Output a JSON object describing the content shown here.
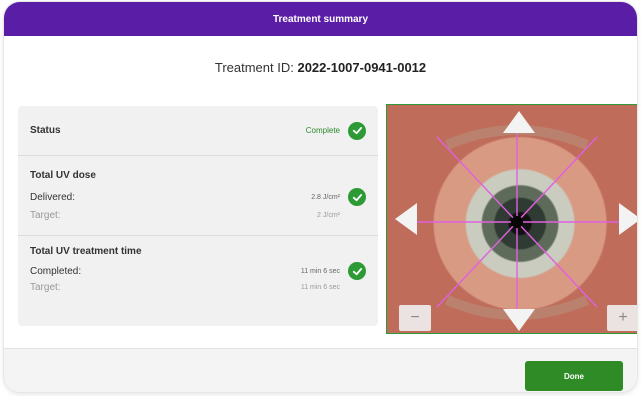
{
  "dialog": {
    "title": "Treatment summary",
    "treatment_id_label": "Treatment ID:",
    "treatment_id_value": "2022-1007-0941-0012"
  },
  "summary": {
    "status": {
      "label": "Status",
      "value": "Complete"
    },
    "uv_dose": {
      "label": "Total UV dose",
      "delivered_label": "Delivered:",
      "delivered_value": "2.8 J/cm²",
      "target_label": "Target:",
      "target_value": "2 J/cm²"
    },
    "uv_time": {
      "label": "Total UV treatment time",
      "completed_label": "Completed:",
      "completed_value": "11 min 6 sec",
      "target_label": "Target:",
      "target_value": "11 min 6 sec"
    }
  },
  "viewer": {
    "zoom_out_label": "−",
    "zoom_in_label": "+"
  },
  "footer": {
    "done_label": "Done"
  },
  "colors": {
    "title_bar": "#5a1ea6",
    "check": "#2e9a36",
    "done_button": "#2e8b26",
    "overlay_lines": "#e060e0"
  }
}
